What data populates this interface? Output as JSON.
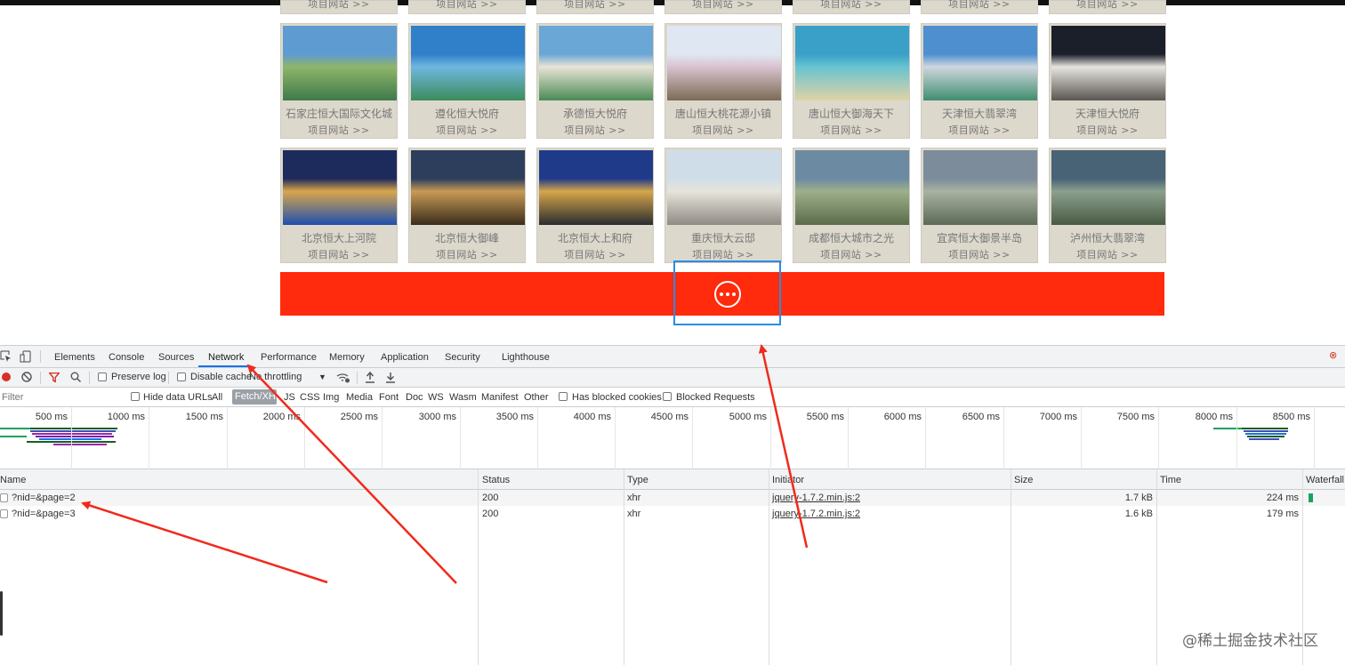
{
  "colors": {
    "accent_red": "#ff2b0c",
    "highlight_blue": "#2a8ce8",
    "annotation_red": "#f02a1c",
    "devtools_active_tab": "#1a73e8"
  },
  "projects": {
    "row0": [
      "项目网站 >>",
      "项目网站 >>",
      "项目网站 >>",
      "项目网站 >>",
      "项目网站 >>",
      "项目网站 >>",
      "项目网站 >>"
    ],
    "row1": [
      {
        "name": "石家庄恒大国际文化城",
        "link": "项目网站 >>"
      },
      {
        "name": "遵化恒大悦府",
        "link": "项目网站 >>"
      },
      {
        "name": "承德恒大悦府",
        "link": "项目网站 >>"
      },
      {
        "name": "唐山恒大桃花源小镇",
        "link": "项目网站 >>"
      },
      {
        "name": "唐山恒大御海天下",
        "link": "项目网站 >>"
      },
      {
        "name": "天津恒大翡翠湾",
        "link": "项目网站 >>"
      },
      {
        "name": "天津恒大悦府",
        "link": "项目网站 >>"
      }
    ],
    "row2": [
      {
        "name": "北京恒大上河院",
        "link": "项目网站 >>"
      },
      {
        "name": "北京恒大御峰",
        "link": "项目网站 >>"
      },
      {
        "name": "北京恒大上和府",
        "link": "项目网站 >>"
      },
      {
        "name": "重庆恒大云邸",
        "link": "项目网站 >>"
      },
      {
        "name": "成都恒大城市之光",
        "link": "项目网站 >>"
      },
      {
        "name": "宜宾恒大御景半岛",
        "link": "项目网站 >>"
      },
      {
        "name": "泸州恒大翡翠湾",
        "link": "项目网站 >>"
      }
    ]
  },
  "load_more": {
    "icon": "ellipsis-icon"
  },
  "devtools": {
    "tabs": [
      "Elements",
      "Console",
      "Sources",
      "Network",
      "Performance",
      "Memory",
      "Application",
      "Security",
      "Lighthouse"
    ],
    "active_tab": "Network",
    "toolbar": {
      "preserve_log": "Preserve log",
      "disable_cache": "Disable cache",
      "throttling": "No throttling"
    },
    "filter": {
      "placeholder": "Filter",
      "hide_data_urls": "Hide data URLs",
      "types": [
        "All",
        "Fetch/XHR",
        "JS",
        "CSS",
        "Img",
        "Media",
        "Font",
        "Doc",
        "WS",
        "Wasm",
        "Manifest",
        "Other"
      ],
      "selected_type": "Fetch/XHR",
      "has_blocked_cookies": "Has blocked cookies",
      "blocked_requests": "Blocked Requests"
    },
    "timeline_ticks": [
      "500 ms",
      "1000 ms",
      "1500 ms",
      "2000 ms",
      "2500 ms",
      "3000 ms",
      "3500 ms",
      "4000 ms",
      "4500 ms",
      "5000 ms",
      "5500 ms",
      "6000 ms",
      "6500 ms",
      "7000 ms",
      "7500 ms",
      "8000 ms",
      "8500 ms"
    ],
    "columns": [
      "Name",
      "Status",
      "Type",
      "Initiator",
      "Size",
      "Time",
      "Waterfall"
    ],
    "requests": [
      {
        "name": "?nid=&page=2",
        "status": "200",
        "type": "xhr",
        "initiator": "jquery-1.7.2.min.js:2",
        "size": "1.7 kB",
        "time": "224 ms"
      },
      {
        "name": "?nid=&page=3",
        "status": "200",
        "type": "xhr",
        "initiator": "jquery-1.7.2.min.js:2",
        "size": "1.6 kB",
        "time": "179 ms"
      }
    ]
  },
  "watermark": "@稀土掘金技术社区"
}
